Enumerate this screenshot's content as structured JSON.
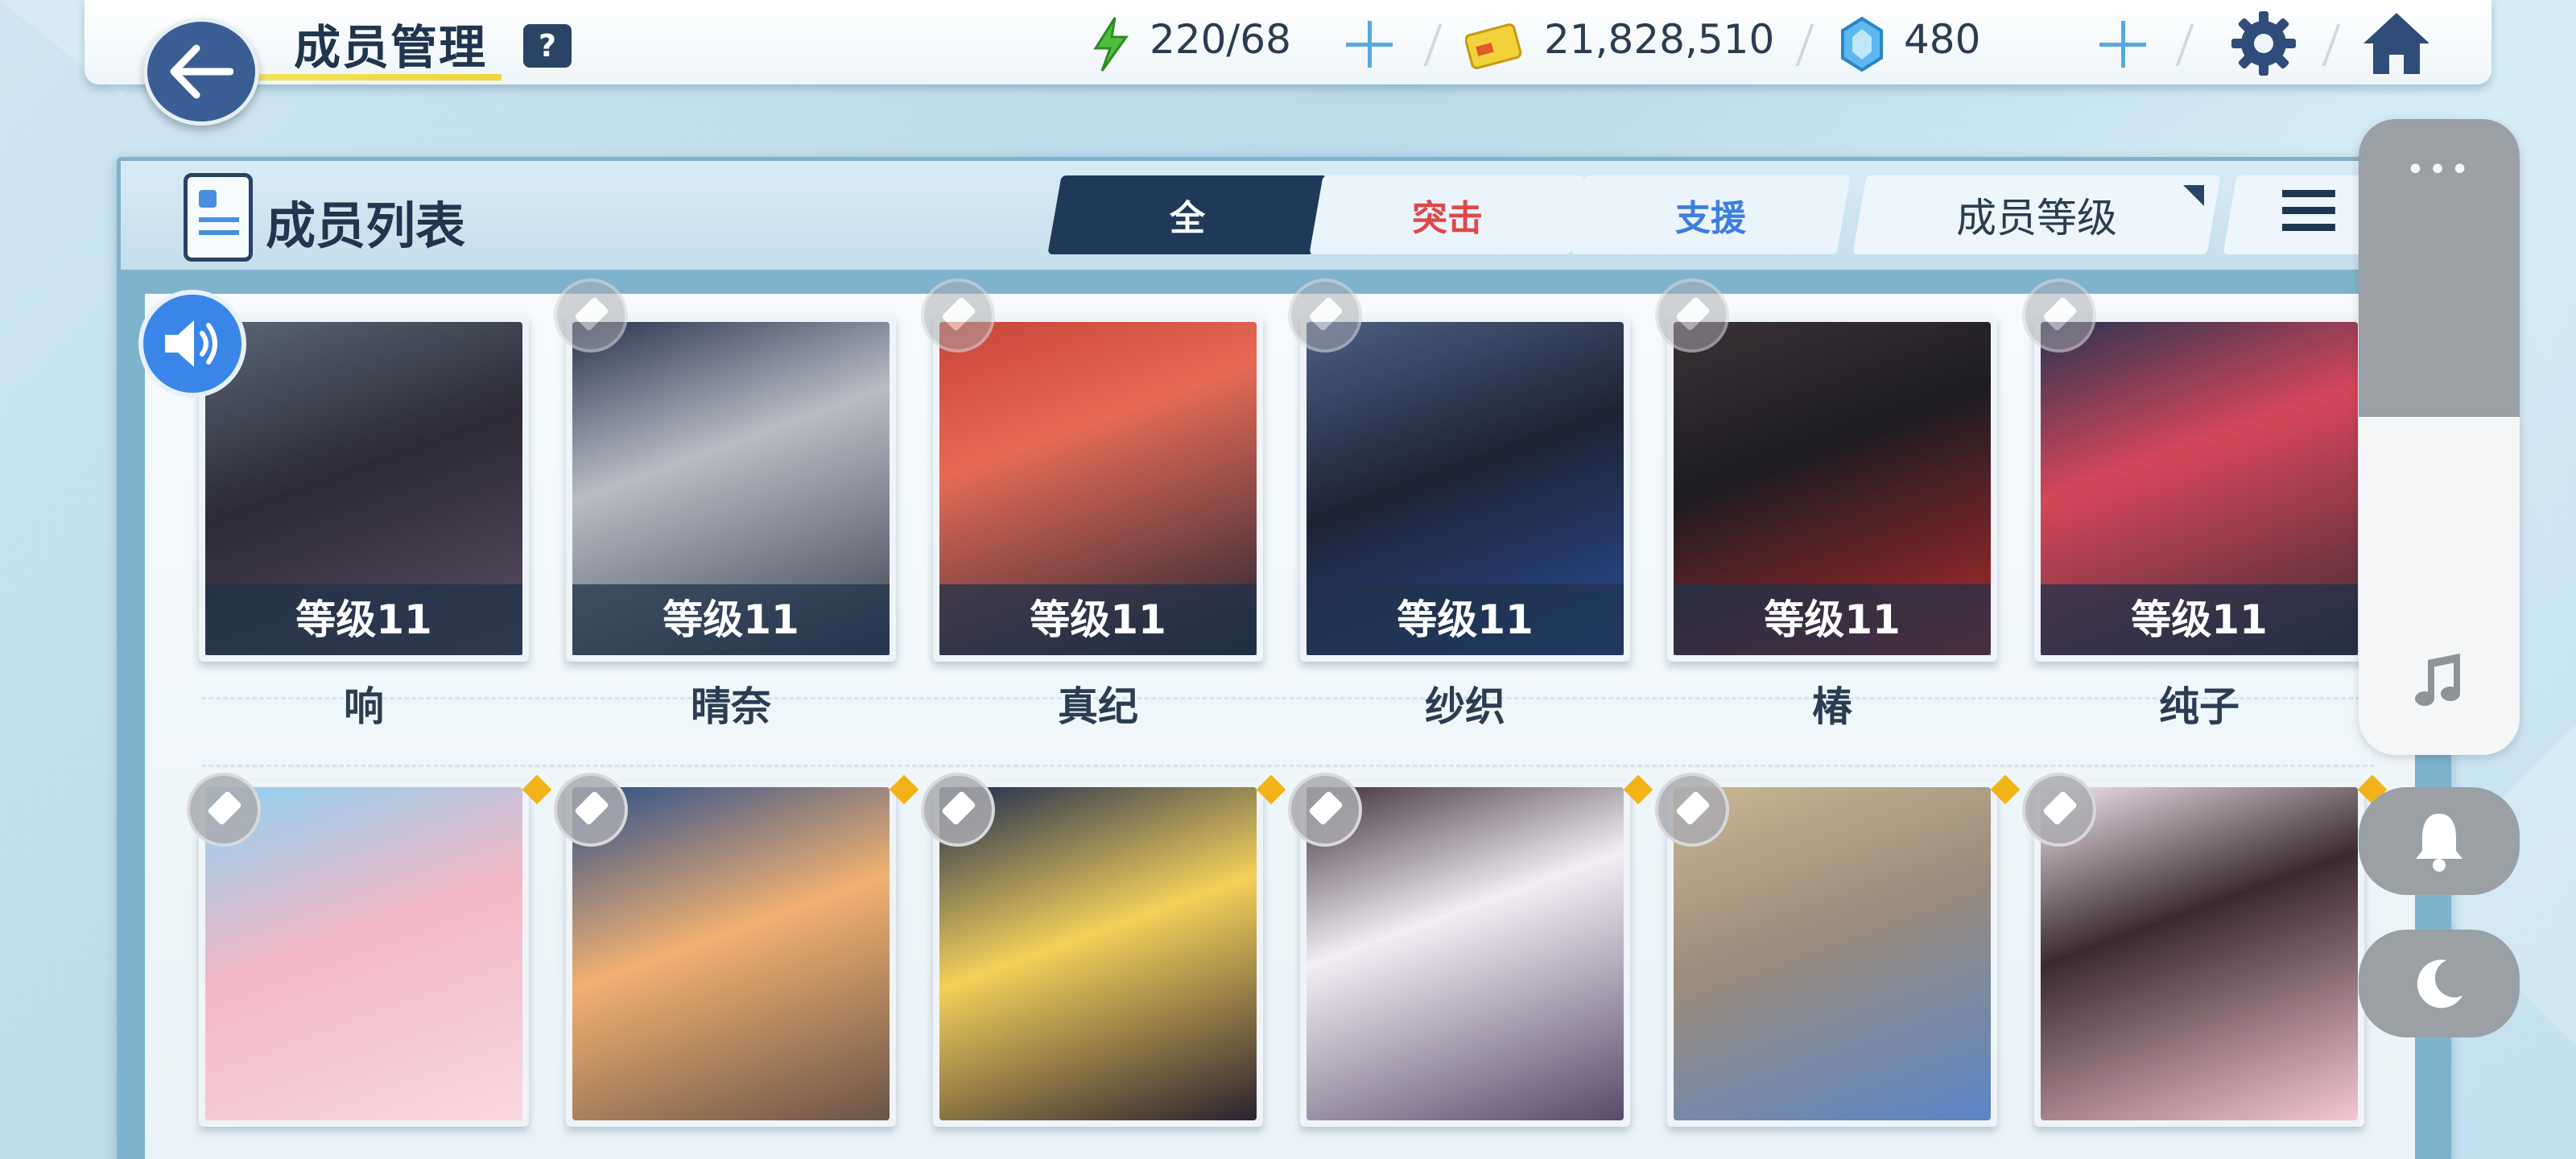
{
  "header": {
    "title": "成员管理",
    "help_label": "?",
    "stamina": "220/68",
    "credits": "21,828,510",
    "gems": "480"
  },
  "panel": {
    "title": "成员列表",
    "tabs": [
      {
        "label": "全",
        "active": true
      },
      {
        "label": "突击",
        "active": false
      },
      {
        "label": "支援",
        "active": false
      }
    ],
    "sort_label": "成员等级"
  },
  "members_row1": [
    {
      "name": "响",
      "level": "等级11"
    },
    {
      "name": "晴奈",
      "level": "等级11"
    },
    {
      "name": "真纪",
      "level": "等级11"
    },
    {
      "name": "纱织",
      "level": "等级11"
    },
    {
      "name": "椿",
      "level": "等级11"
    },
    {
      "name": "纯子",
      "level": "等级11"
    }
  ],
  "colors": {
    "accent": "#1f3a59",
    "assault": "#e04848",
    "support": "#3d7ee0",
    "highlight": "#f5e25a",
    "gold": "#f2b318"
  },
  "icons": [
    "back-arrow-icon",
    "help-icon",
    "stamina-bolt-icon",
    "credit-card-icon",
    "gem-icon",
    "plus-icon",
    "gear-icon",
    "home-icon",
    "member-list-icon",
    "hamburger-icon",
    "speaker-icon",
    "pin-icon",
    "more-dots-icon",
    "music-note-icon",
    "bell-icon",
    "moon-icon"
  ]
}
